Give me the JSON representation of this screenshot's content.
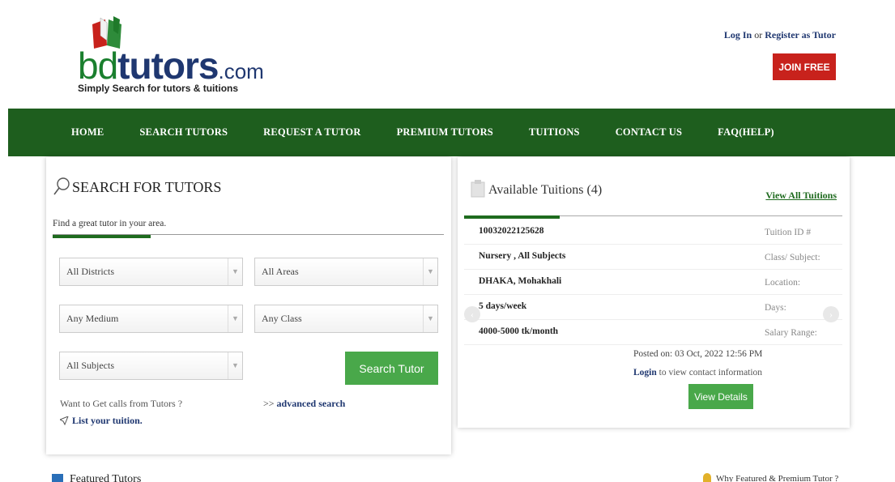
{
  "logo": {
    "part1": "bd",
    "part2": "tutors",
    "part3": ".com",
    "tagline": "Simply Search for tutors & tuitions"
  },
  "auth": {
    "login": "Log In",
    "or": " or ",
    "register": "Register as Tutor",
    "join": "JOIN FREE"
  },
  "nav": [
    "HOME",
    "SEARCH TUTORS",
    "REQUEST A TUTOR",
    "PREMIUM TUTORS",
    "TUITIONS",
    "CONTACT US",
    "FAQ(HELP)"
  ],
  "search": {
    "title": "SEARCH FOR TUTORS",
    "subtitle": "Find a great tutor in your area.",
    "district": "All Districts",
    "area": "All Areas",
    "medium": "Any Medium",
    "class": "Any Class",
    "subjects": "All Subjects",
    "button": "Search Tutor",
    "want_calls": "Want to Get calls from Tutors ?",
    "adv_prefix": ">> ",
    "adv_link": "advanced search",
    "list_tuition": "List your tuition."
  },
  "tuitions": {
    "title": "Available Tuitions (4)",
    "view_all": "View All Tuitions",
    "rows": [
      {
        "value": "10032022125628",
        "key": "Tuition ID #"
      },
      {
        "value": "Nursery , All Subjects",
        "key": "Class/ Subject:"
      },
      {
        "value": "DHAKA, Mohakhali",
        "key": "Location:"
      },
      {
        "value": "5 days/week",
        "key": "Days:"
      },
      {
        "value": "4000-5000 tk/month",
        "key": "Salary Range:"
      }
    ],
    "posted": "Posted on: 03 Oct, 2022 12:56 PM",
    "login_link": "Login",
    "login_rest": " to view contact information",
    "view_details": "View Details"
  },
  "footer": {
    "featured": "Featured Tutors",
    "why": "Why Featured & Premium Tutor ?"
  },
  "colors": {
    "nav_green": "#1e5e1e",
    "button_green": "#49a84a",
    "join_red": "#c8221c",
    "brand_navy": "#1f3770"
  }
}
